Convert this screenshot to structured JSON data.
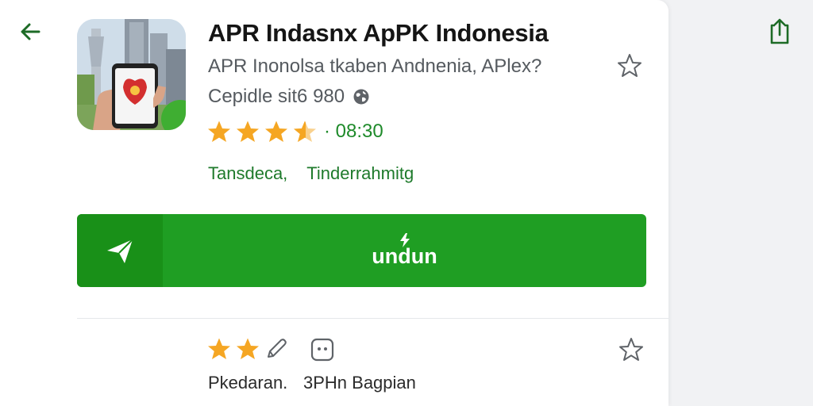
{
  "app": {
    "title": "APR Indasnx ApPK Indonesia",
    "developer": "APR Inonolsa tkaben Andnenia, APlex?",
    "size_text": "Cepidle sit6 980"
  },
  "rating": {
    "stars_filled": 3.5,
    "stars_total": 4,
    "value_text": "· 08:30"
  },
  "tags": [
    "Tansdeca,",
    "Tinderrahmitg"
  ],
  "install": {
    "label": "undun"
  },
  "bottom": {
    "reviews_label": "Pkedaran.",
    "share_label": "3PHn Bagpian"
  },
  "colors": {
    "brand_green": "#1f9e23",
    "brand_green_dark": "#199018",
    "star_orange": "#f5a623",
    "text_green": "#1e7a2b",
    "icon_green": "#1d6b26"
  },
  "icons": {
    "back": "arrow-left-icon",
    "share": "share-icon",
    "wishlist": "star-outline-icon",
    "globe": "globe-icon",
    "install": "paper-plane-icon",
    "edit": "pencil-icon",
    "chat": "chat-icon"
  }
}
